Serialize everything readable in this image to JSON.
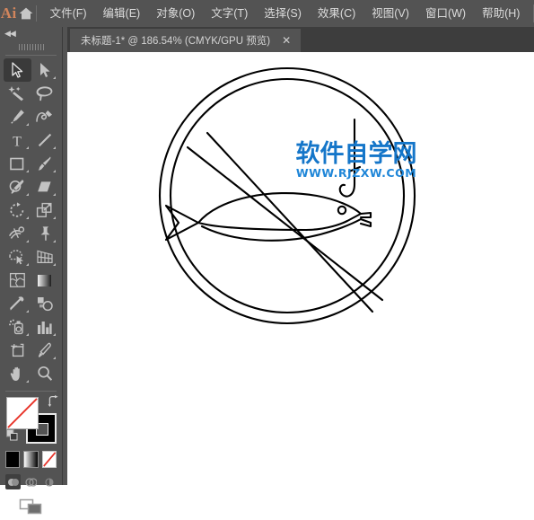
{
  "app": {
    "logo_text": "Ai",
    "bg_chrome": "#535353",
    "bg_tabbar": "#3d3d3d",
    "canvas_bg": "#ffffff",
    "accent_logo": "#d2855c"
  },
  "menubar": {
    "home_icon": "home-icon",
    "items": [
      {
        "label": "文件(F)"
      },
      {
        "label": "编辑(E)"
      },
      {
        "label": "对象(O)"
      },
      {
        "label": "文字(T)"
      },
      {
        "label": "选择(S)"
      },
      {
        "label": "效果(C)"
      },
      {
        "label": "视图(V)"
      },
      {
        "label": "窗口(W)"
      },
      {
        "label": "帮助(H)"
      }
    ]
  },
  "tabbar": {
    "tab_title": "未标题-1* @ 186.54% (CMYK/GPU 预览)",
    "close_label": "✕"
  },
  "toolbar": {
    "collapse_label": "◀◀",
    "tools": [
      {
        "name": "selection-tool",
        "icon": "arrow-solid-icon",
        "active": true,
        "corner": false
      },
      {
        "name": "direct-selection-tool",
        "icon": "arrow-filled-icon",
        "active": false,
        "corner": true
      },
      {
        "name": "magic-wand-tool",
        "icon": "magic-wand-icon",
        "active": false,
        "corner": false
      },
      {
        "name": "lasso-tool",
        "icon": "lasso-icon",
        "active": false,
        "corner": false
      },
      {
        "name": "pen-tool",
        "icon": "pen-icon",
        "active": false,
        "corner": true
      },
      {
        "name": "curvature-tool",
        "icon": "curvature-icon",
        "active": false,
        "corner": false
      },
      {
        "name": "type-tool",
        "icon": "type-t-icon",
        "active": false,
        "corner": true
      },
      {
        "name": "line-segment-tool",
        "icon": "line-icon",
        "active": false,
        "corner": true
      },
      {
        "name": "rectangle-tool",
        "icon": "rectangle-icon",
        "active": false,
        "corner": true
      },
      {
        "name": "paintbrush-tool",
        "icon": "paintbrush-icon",
        "active": false,
        "corner": true
      },
      {
        "name": "shaper-tool",
        "icon": "shaper-icon",
        "active": false,
        "corner": true
      },
      {
        "name": "eraser-tool",
        "icon": "eraser-icon",
        "active": false,
        "corner": true
      },
      {
        "name": "rotate-tool",
        "icon": "rotate-icon",
        "active": false,
        "corner": true
      },
      {
        "name": "scale-tool",
        "icon": "scale-icon",
        "active": false,
        "corner": true
      },
      {
        "name": "width-tool",
        "icon": "width-icon",
        "active": false,
        "corner": true
      },
      {
        "name": "free-transform-tool",
        "icon": "pushpin-icon",
        "active": false,
        "corner": true
      },
      {
        "name": "shape-builder-tool",
        "icon": "shape-builder-icon",
        "active": false,
        "corner": true
      },
      {
        "name": "perspective-grid-tool",
        "icon": "perspective-grid-icon",
        "active": false,
        "corner": true
      },
      {
        "name": "mesh-tool",
        "icon": "mesh-icon",
        "active": false,
        "corner": false
      },
      {
        "name": "gradient-tool",
        "icon": "gradient-icon",
        "active": false,
        "corner": false
      },
      {
        "name": "eyedropper-tool",
        "icon": "eyedropper-icon",
        "active": false,
        "corner": true
      },
      {
        "name": "blend-tool",
        "icon": "blend-icon",
        "active": false,
        "corner": false
      },
      {
        "name": "symbol-sprayer-tool",
        "icon": "symbol-sprayer-icon",
        "active": false,
        "corner": true
      },
      {
        "name": "column-graph-tool",
        "icon": "bar-chart-icon",
        "active": false,
        "corner": true
      },
      {
        "name": "artboard-tool",
        "icon": "artboard-icon",
        "active": false,
        "corner": false
      },
      {
        "name": "slice-tool",
        "icon": "slice-knife-icon",
        "active": false,
        "corner": true
      },
      {
        "name": "hand-tool",
        "icon": "hand-icon",
        "active": false,
        "corner": true
      },
      {
        "name": "zoom-tool",
        "icon": "magnifier-icon",
        "active": false,
        "corner": false
      }
    ],
    "fill_swatch": {
      "name": "fill-swatch",
      "color": "#ffffff",
      "is_none": true
    },
    "stroke_swatch": {
      "name": "stroke-swatch",
      "color": "#000000"
    },
    "swap_icon": "swap-arrow-icon",
    "default_icon": "default-colors-icon",
    "modes": [
      {
        "name": "color-mode-button",
        "icon": "solid-color-icon"
      },
      {
        "name": "gradient-mode-button",
        "icon": "gradient-swatch-icon"
      },
      {
        "name": "none-mode-button",
        "icon": "none-swatch-icon",
        "selected": true
      }
    ],
    "draw_modes": [
      {
        "name": "draw-normal-button",
        "icon": "draw-normal-icon",
        "selected": true
      },
      {
        "name": "draw-behind-button",
        "icon": "draw-behind-icon",
        "selected": false
      },
      {
        "name": "draw-inside-button",
        "icon": "draw-inside-icon",
        "selected": false
      }
    ],
    "screen_mode": {
      "name": "screen-mode-button",
      "icon": "screen-mode-icon"
    }
  },
  "artwork": {
    "title": "no-fishing-sign",
    "stroke_color": "#000000",
    "watermark": {
      "chinese": "软件自学网",
      "url": "WWW.RJZXW.COM",
      "color": "#1576c9"
    }
  }
}
